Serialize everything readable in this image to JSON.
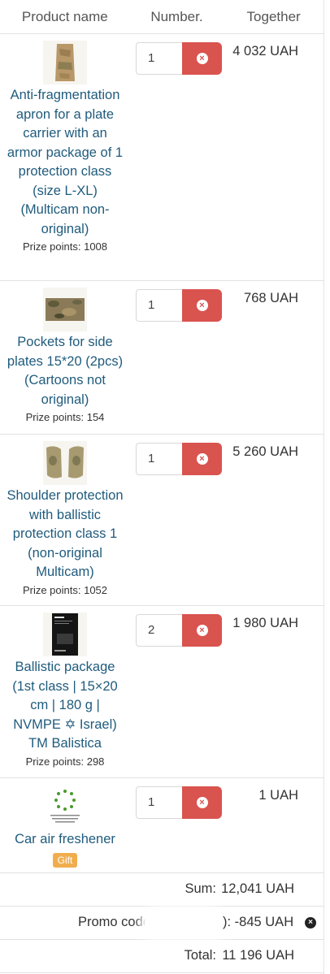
{
  "header": {
    "product_name": "Product name",
    "number": "Number.",
    "together": "Together"
  },
  "items": [
    {
      "title": "Anti-fragmentation apron for a plate carrier with an armor package of 1 protection class (size L-XL) (Multicam non-original)",
      "points": "Prize points: 1008",
      "qty": "1",
      "price": "4 032 UAH"
    },
    {
      "title": "Pockets for side plates 15*20 (2pcs) (Cartoons not original)",
      "points": "Prize points: 154",
      "qty": "1",
      "price": "768 UAH"
    },
    {
      "title": "Shoulder protection with ballistic protection class 1 (non-original Multicam)",
      "points": "Prize points: 1052",
      "qty": "1",
      "price": "5 260 UAH"
    },
    {
      "title": "Ballistic package (1st class | 15×20 cm | 180 g | NVMPE ✡ Israel) TM Balistica",
      "points": "Prize points: 298",
      "qty": "2",
      "price": "1 980 UAH"
    },
    {
      "title": "Car air freshener",
      "gift": "Gift",
      "qty": "1",
      "price": "1 UAH"
    }
  ],
  "summary": {
    "sum_label": "Sum:",
    "sum_value": "12,041 UAH",
    "promo_label": "Promo code",
    "promo_value": "): -845 UAH",
    "total_label": "Total:",
    "total_value": "11 196 UAH"
  },
  "icons": {
    "remove": "times-circle-icon"
  },
  "colors": {
    "remove_button": "#d9534f",
    "link": "#1f5b7d",
    "gift_badge": "#f0ad4e"
  }
}
